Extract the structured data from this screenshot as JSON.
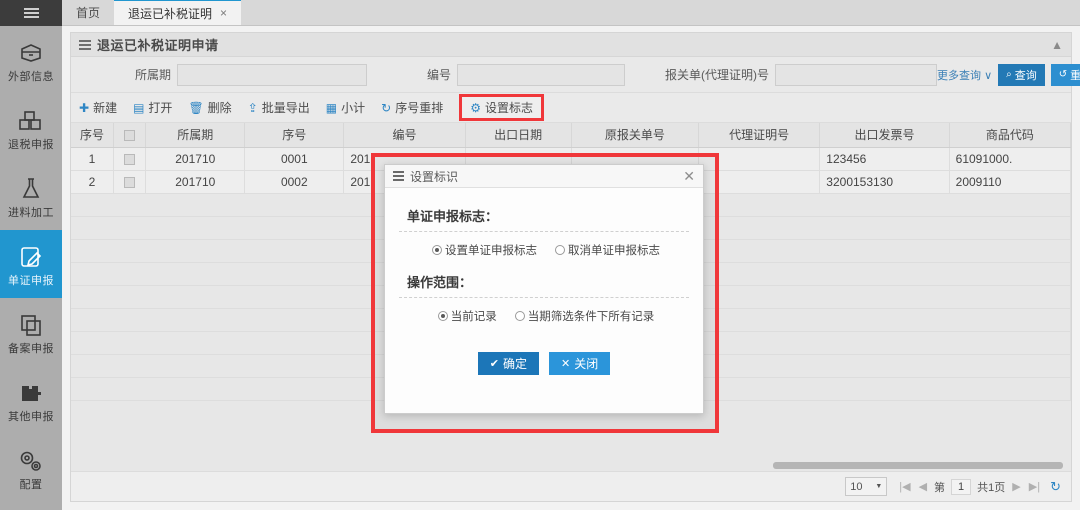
{
  "sidebar": {
    "menu_icon": "hamburger-icon",
    "items": [
      {
        "label": "外部信息",
        "icon": "database-icon",
        "active": false
      },
      {
        "label": "退税申报",
        "icon": "boxes-icon",
        "active": false
      },
      {
        "label": "进料加工",
        "icon": "flask-icon",
        "active": false
      },
      {
        "label": "单证申报",
        "icon": "edit-document-icon",
        "active": true
      },
      {
        "label": "备案申报",
        "icon": "copy-icon",
        "active": false
      },
      {
        "label": "其他申报",
        "icon": "puzzle-icon",
        "active": false
      },
      {
        "label": "配置",
        "icon": "gears-icon",
        "active": false
      }
    ]
  },
  "tabs": [
    {
      "label": "首页",
      "active": false,
      "closable": false
    },
    {
      "label": "退运已补税证明",
      "active": true,
      "closable": true,
      "close_glyph": "×"
    }
  ],
  "panel": {
    "title": "退运已补税证明申请",
    "collapse_glyph": "▲"
  },
  "filters": {
    "fields": [
      {
        "label": "所属期",
        "value": "",
        "placeholder": ""
      },
      {
        "label": "编号",
        "value": "",
        "placeholder": ""
      },
      {
        "label": "报关单(代理证明)号",
        "value": "",
        "placeholder": ""
      }
    ],
    "more_query": "更多查询 ∨",
    "search_button": {
      "label": "查询",
      "icon": "search-icon",
      "glyph": "⌕"
    },
    "reset_button": {
      "label": "重置",
      "icon": "reset-icon",
      "glyph": "↺"
    }
  },
  "toolbar": {
    "buttons": [
      {
        "label": "新建",
        "icon": "plus-icon",
        "glyph": "✚",
        "highlighted": false
      },
      {
        "label": "打开",
        "icon": "open-folder-icon",
        "glyph": "▤",
        "highlighted": false
      },
      {
        "label": "删除",
        "icon": "trash-icon",
        "glyph": "🗑",
        "highlighted": false
      },
      {
        "label": "批量导出",
        "icon": "export-icon",
        "glyph": "⇪",
        "highlighted": false
      },
      {
        "label": "小计",
        "icon": "subtotal-icon",
        "glyph": "▦",
        "highlighted": false
      },
      {
        "label": "序号重排",
        "icon": "refresh-icon",
        "glyph": "↻",
        "highlighted": false
      },
      {
        "label": "设置标志",
        "icon": "gear-icon",
        "glyph": "⚙",
        "highlighted": true
      }
    ]
  },
  "table": {
    "columns": [
      "序号",
      "",
      "所属期",
      "序号",
      "编号",
      "出口日期",
      "原报关单号",
      "代理证明号",
      "出口发票号",
      "商品代码"
    ],
    "rows": [
      {
        "index": "1",
        "period": "201710",
        "seq": "0001",
        "code": "201",
        "export_date": "",
        "declaration_no": "",
        "agent_cert_no": "",
        "invoice_no": "123456",
        "goods_code": "61091000."
      },
      {
        "index": "2",
        "period": "201710",
        "seq": "0002",
        "code": "201",
        "export_date": "",
        "declaration_no": "",
        "agent_cert_no": "",
        "invoice_no": "3200153130",
        "goods_code": "2009110"
      }
    ],
    "empty_row_count": 9
  },
  "pagination": {
    "page_size": "10",
    "page_size_caret": "▼",
    "first_glyph": "|◀",
    "prev_glyph": "◀",
    "page_label": "第",
    "page_number": "1",
    "total_label": "共1页",
    "next_glyph": "▶",
    "last_glyph": "▶|",
    "refresh_glyph": "↻"
  },
  "modal": {
    "title": "设置标识",
    "close_glyph": "✕",
    "sections": [
      {
        "title": "单证申报标志：",
        "options": [
          {
            "label": "设置单证申报标志",
            "checked": true
          },
          {
            "label": "取消单证申报标志",
            "checked": false
          }
        ]
      },
      {
        "title": "操作范围：",
        "options": [
          {
            "label": "当前记录",
            "checked": true
          },
          {
            "label": "当期筛选条件下所有记录",
            "checked": false
          }
        ]
      }
    ],
    "confirm_button": {
      "label": "确定",
      "icon": "check-icon",
      "glyph": "✔"
    },
    "close_button": {
      "label": "关闭",
      "icon": "close-icon",
      "glyph": "✕"
    }
  },
  "colors": {
    "accent_blue": "#2196cf",
    "button_blue": "#2379b5",
    "highlight_red": "#f0373a",
    "sidebar_gray": "#adadad"
  }
}
